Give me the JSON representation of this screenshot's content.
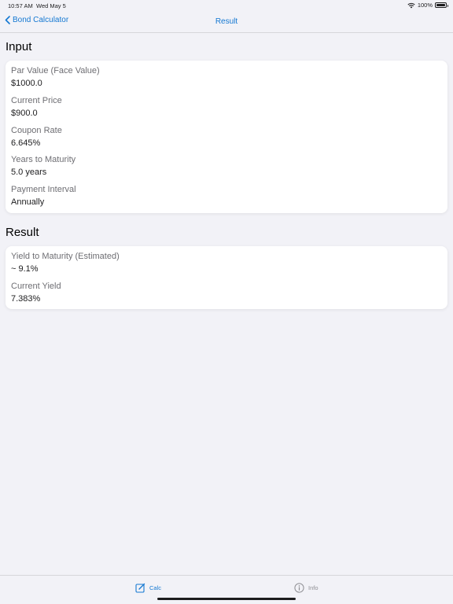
{
  "status_bar": {
    "time": "10:57 AM",
    "date": "Wed May 5",
    "battery": "100%"
  },
  "nav": {
    "back_label": "Bond Calculator",
    "title": "Result"
  },
  "input_section": {
    "header": "Input",
    "fields": [
      {
        "label": "Par Value (Face Value)",
        "value": "$1000.0"
      },
      {
        "label": "Current Price",
        "value": "$900.0"
      },
      {
        "label": "Coupon Rate",
        "value": "6.645%"
      },
      {
        "label": "Years to Maturity",
        "value": "5.0 years"
      },
      {
        "label": "Payment Interval",
        "value": "Annually"
      }
    ]
  },
  "result_section": {
    "header": "Result",
    "fields": [
      {
        "label": "Yield to Maturity (Estimated)",
        "value": "~ 9.1%"
      },
      {
        "label": "Current Yield",
        "value": "7.383%"
      }
    ]
  },
  "tab_bar": {
    "tabs": [
      {
        "label": "Calc",
        "icon": "compose-icon",
        "selected": true
      },
      {
        "label": "Info",
        "icon": "info-icon",
        "selected": false
      }
    ],
    "selected_color": "#1478d2",
    "unselected_color": "#8e8e93"
  },
  "colors": {
    "accent": "#1478d2",
    "background": "#f2f2f7",
    "card": "#ffffff"
  }
}
